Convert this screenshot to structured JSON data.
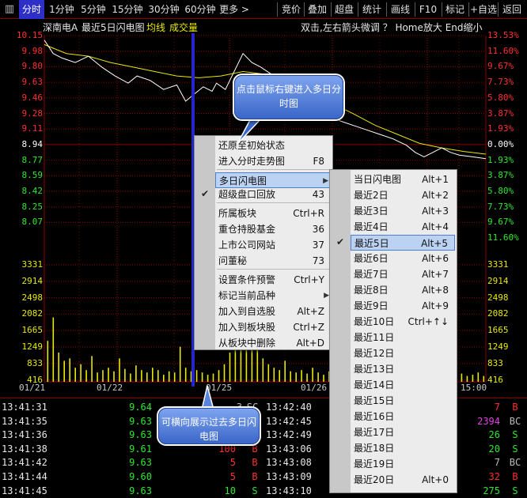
{
  "toolbar": {
    "menu_glyph": "▥",
    "tabs": [
      "分时",
      "1分钟",
      "5分钟",
      "15分钟",
      "30分钟",
      "60分钟",
      "更多 >"
    ],
    "right_buttons": [
      "竞价",
      "叠加",
      "超盘",
      "统计",
      "画线",
      "F10",
      "标记",
      "+自选",
      "返回"
    ]
  },
  "chart": {
    "stock_name": "深南电A",
    "mode_title": "最近5日闪电图",
    "legend_avg": "均线",
    "legend_vol": "成交量",
    "hint": "双击,左右箭头微调 ？ Home放大 End缩小",
    "colors": {
      "price": "#ffffff",
      "avg": "#e8e800",
      "up": "#ff3030",
      "down": "#2ee82e",
      "grid": "#8a0000",
      "volume": "#e8e800"
    }
  },
  "chart_data": {
    "type": "line",
    "x": [
      "01/21",
      "01/22",
      "01/25",
      "01/26",
      "15:00"
    ],
    "price_axis": [
      "10.15",
      "9.98",
      "9.80",
      "9.63",
      "9.46",
      "9.28",
      "9.11",
      "8.94",
      "8.77",
      "8.59",
      "8.42",
      "8.25",
      "8.07"
    ],
    "pct_axis": [
      "13.53%",
      "11.60%",
      "9.67%",
      "7.73%",
      "5.80%",
      "3.87%",
      "1.93%",
      "0.00%",
      "1.93%",
      "3.87%",
      "5.80%",
      "7.73%",
      "9.67%",
      "11.60%"
    ],
    "volume_axis": [
      "3331",
      "2914",
      "2498",
      "2082",
      "1665",
      "1249",
      "833",
      "416"
    ],
    "ylim": [
      8.07,
      10.15
    ],
    "series": [],
    "price_path": [
      [
        0,
        10.1
      ],
      [
        0.02,
        9.95
      ],
      [
        0.04,
        9.9
      ],
      [
        0.07,
        9.85
      ],
      [
        0.1,
        9.92
      ],
      [
        0.13,
        9.8
      ],
      [
        0.16,
        9.7
      ],
      [
        0.19,
        9.62
      ],
      [
        0.21,
        9.7
      ],
      [
        0.24,
        9.65
      ],
      [
        0.27,
        9.55
      ],
      [
        0.3,
        9.6
      ],
      [
        0.32,
        9.42
      ],
      [
        0.34,
        9.5
      ],
      [
        0.36,
        9.58
      ],
      [
        0.38,
        9.53
      ],
      [
        0.39,
        9.62
      ],
      [
        0.41,
        9.55
      ],
      [
        0.43,
        9.75
      ],
      [
        0.45,
        9.95
      ],
      [
        0.47,
        9.85
      ],
      [
        0.49,
        9.8
      ],
      [
        0.52,
        9.7
      ],
      [
        0.55,
        9.6
      ],
      [
        0.58,
        9.45
      ],
      [
        0.61,
        9.4
      ],
      [
        0.64,
        9.32
      ],
      [
        0.67,
        9.2
      ],
      [
        0.7,
        9.15
      ],
      [
        0.73,
        9.1
      ],
      [
        0.76,
        9.05
      ],
      [
        0.79,
        9.0
      ],
      [
        0.82,
        8.93
      ],
      [
        0.84,
        8.85
      ],
      [
        0.86,
        8.8
      ],
      [
        0.88,
        8.85
      ],
      [
        0.9,
        8.9
      ],
      [
        0.92,
        8.85
      ],
      [
        0.94,
        8.82
      ],
      [
        0.97,
        8.8
      ],
      [
        1.0,
        8.78
      ]
    ],
    "avg_path": [
      [
        0,
        10.05
      ],
      [
        0.05,
        9.95
      ],
      [
        0.1,
        9.92
      ],
      [
        0.15,
        9.85
      ],
      [
        0.2,
        9.8
      ],
      [
        0.25,
        9.75
      ],
      [
        0.3,
        9.7
      ],
      [
        0.35,
        9.68
      ],
      [
        0.4,
        9.7
      ],
      [
        0.45,
        9.75
      ],
      [
        0.5,
        9.72
      ],
      [
        0.55,
        9.62
      ],
      [
        0.6,
        9.5
      ],
      [
        0.65,
        9.4
      ],
      [
        0.7,
        9.28
      ],
      [
        0.75,
        9.15
      ],
      [
        0.8,
        9.05
      ],
      [
        0.85,
        8.95
      ],
      [
        0.9,
        8.9
      ],
      [
        0.95,
        8.86
      ],
      [
        1.0,
        8.83
      ]
    ],
    "volume_bars": [
      0.35,
      0.55,
      0.25,
      0.18,
      0.2,
      0.12,
      0.15,
      0.1,
      0.22,
      0.08,
      0.1,
      0.12,
      0.09,
      0.2,
      0.11,
      0.07,
      0.14,
      0.1,
      0.08,
      0.12,
      0.1,
      0.06,
      0.09,
      0.08,
      0.3,
      0.12,
      0.09,
      0.1,
      0.08,
      0.06,
      0.07,
      0.1,
      0.15,
      0.25,
      0.6,
      0.85,
      0.7,
      0.45,
      0.3,
      0.2,
      0.15,
      0.12,
      0.1,
      0.18,
      0.09,
      0.08,
      0.1,
      0.07,
      0.12,
      0.08,
      0.06,
      0.09,
      0.07,
      0.05,
      0.08,
      0.06,
      0.07,
      0.09,
      0.06,
      0.05,
      0.08,
      0.06,
      0.07,
      0.05,
      0.06,
      0.08,
      0.05,
      0.07,
      0.06,
      0.05,
      0.09,
      0.06,
      0.07,
      0.05,
      0.06,
      0.07,
      0.05,
      0.06,
      0.08,
      0.05
    ]
  },
  "context_menu": {
    "items": [
      {
        "label": "还原至初始状态",
        "shortcut": ""
      },
      {
        "label": "进入分时走势图",
        "shortcut": "F8"
      },
      {
        "label": "多日闪电图",
        "shortcut": "",
        "submenu": true,
        "highlight": true
      },
      {
        "label": "超级盘口回放",
        "shortcut": "43",
        "checked": true
      },
      {
        "label": "所属板块",
        "shortcut": "Ctrl+R"
      },
      {
        "label": "重仓持股基金",
        "shortcut": "36"
      },
      {
        "label": "上市公司网站",
        "shortcut": "37"
      },
      {
        "label": "问董秘",
        "shortcut": "73"
      },
      {
        "label": "设置条件预警",
        "shortcut": "Ctrl+Y"
      },
      {
        "label": "标记当前品种",
        "shortcut": "",
        "submenu": true
      },
      {
        "label": "加入到自选股",
        "shortcut": "Alt+Z"
      },
      {
        "label": "加入到板块股",
        "shortcut": "Ctrl+Z"
      },
      {
        "label": "从板块中删除",
        "shortcut": "Alt+D"
      }
    ]
  },
  "submenu": {
    "items": [
      {
        "label": "当日闪电图",
        "shortcut": "Alt+1"
      },
      {
        "label": "最近2日",
        "shortcut": "Alt+2"
      },
      {
        "label": "最近3日",
        "shortcut": "Alt+3"
      },
      {
        "label": "最近4日",
        "shortcut": "Alt+4"
      },
      {
        "label": "最近5日",
        "shortcut": "Alt+5",
        "checked": true
      },
      {
        "label": "最近6日",
        "shortcut": "Alt+6"
      },
      {
        "label": "最近7日",
        "shortcut": "Alt+7"
      },
      {
        "label": "最近8日",
        "shortcut": "Alt+8"
      },
      {
        "label": "最近9日",
        "shortcut": "Alt+9"
      },
      {
        "label": "最近10日",
        "shortcut": "Ctrl+↑↓"
      },
      {
        "label": "最近11日",
        "shortcut": ""
      },
      {
        "label": "最近12日",
        "shortcut": ""
      },
      {
        "label": "最近13日",
        "shortcut": ""
      },
      {
        "label": "最近14日",
        "shortcut": ""
      },
      {
        "label": "最近15日",
        "shortcut": ""
      },
      {
        "label": "最近16日",
        "shortcut": ""
      },
      {
        "label": "最近17日",
        "shortcut": ""
      },
      {
        "label": "最近18日",
        "shortcut": ""
      },
      {
        "label": "最近19日",
        "shortcut": ""
      },
      {
        "label": "最近20日",
        "shortcut": "Alt+0"
      }
    ]
  },
  "callouts": {
    "top": "点击鼠标右键进入多日分时图",
    "bottom": "可横向展示过去多日闪电图"
  },
  "ticks_left": [
    {
      "time": "13:41:31",
      "price": "9.64",
      "vol": "",
      "dir": ""
    },
    {
      "time": "13:41:35",
      "price": "9.63",
      "vol": "",
      "dir": ""
    },
    {
      "time": "13:41:36",
      "price": "9.63",
      "vol": "",
      "dir": ""
    },
    {
      "time": "13:41:38",
      "price": "9.61",
      "vol": "100",
      "dir": "B",
      "dircolor": "#ff3030",
      "volcolor": "#ff3030"
    },
    {
      "time": "13:41:42",
      "price": "9.63",
      "vol": "5",
      "dir": "B",
      "dircolor": "#ff3030",
      "volcolor": "#ff3030"
    },
    {
      "time": "13:41:44",
      "price": "9.60",
      "vol": "5",
      "dir": "B",
      "dircolor": "#ff3030",
      "volcolor": "#ff3030"
    },
    {
      "time": "13:41:45",
      "price": "9.63",
      "vol": "10",
      "dir": "S",
      "dircolor": "#2ee82e",
      "volcolor": "#2ee82e"
    }
  ],
  "ticks_mid": [
    {
      "time": "13:42:40",
      "vol": "3",
      "dir": "SC"
    },
    {
      "time": "13:42:45"
    },
    {
      "time": "13:42:49"
    },
    {
      "time": "13:43:06"
    },
    {
      "time": "13:43:08"
    },
    {
      "time": "13:43:09"
    },
    {
      "time": "13:43:10"
    }
  ],
  "ticks_right": [
    {
      "vol": "7",
      "dir": "B",
      "volcolor": "#ff3030",
      "dircolor": "#ff3030"
    },
    {
      "vol": "2394",
      "dir": "BC",
      "volcolor": "#e040e0",
      "dircolor": "#bbbbbb"
    },
    {
      "vol": "26",
      "dir": "S",
      "volcolor": "#2ee82e",
      "dircolor": "#2ee82e"
    },
    {
      "vol": "20",
      "dir": "S",
      "volcolor": "#2ee82e",
      "dircolor": "#2ee82e"
    },
    {
      "vol": "7",
      "dir": "BC",
      "volcolor": "#bbbbbb",
      "dircolor": "#bbbbbb"
    },
    {
      "vol": "32",
      "dir": "B",
      "volcolor": "#ff3030",
      "dircolor": "#ff3030"
    },
    {
      "vol": "275",
      "dir": "S",
      "volcolor": "#2ee82e",
      "dircolor": "#2ee82e"
    }
  ]
}
